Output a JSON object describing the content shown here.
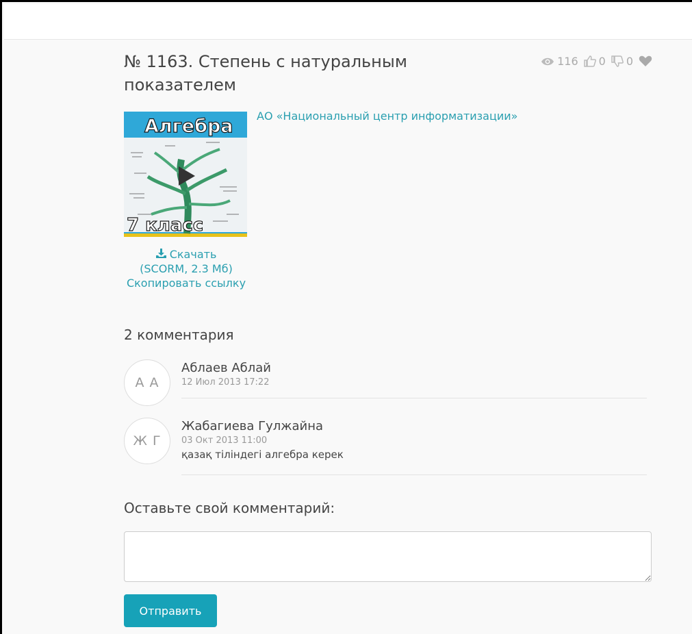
{
  "lesson": {
    "title": "№ 1163. Степень с натуральным показателем",
    "author": "АО «Национальный центр информатизации»",
    "stats": {
      "views": "116",
      "likes": "0",
      "dislikes": "0"
    },
    "thumbnail": {
      "title_text": "Алгебра",
      "grade_text": "7 класс"
    },
    "download": {
      "label": "Скачать",
      "info": "(SCORM, 2.3 Мб)",
      "copy_link": "Скопировать ссылку"
    }
  },
  "comments": {
    "heading": "2 комментария",
    "items": [
      {
        "initials": "А А",
        "author": "Аблаев Аблай",
        "date": "12 Июл 2013 17:22",
        "text": ""
      },
      {
        "initials": "Ж Г",
        "author": "Жабагиева Гулжайна",
        "date": "03 Окт 2013 11:00",
        "text": "қазақ тіліндегі алгебра керек"
      }
    ]
  },
  "form": {
    "heading": "Оставьте свой комментарий:",
    "comment_value": "",
    "submit_label": "Отправить"
  },
  "colors": {
    "accent": "#17a2b8",
    "link": "#2a9fb0",
    "muted": "#aaaaaa"
  }
}
